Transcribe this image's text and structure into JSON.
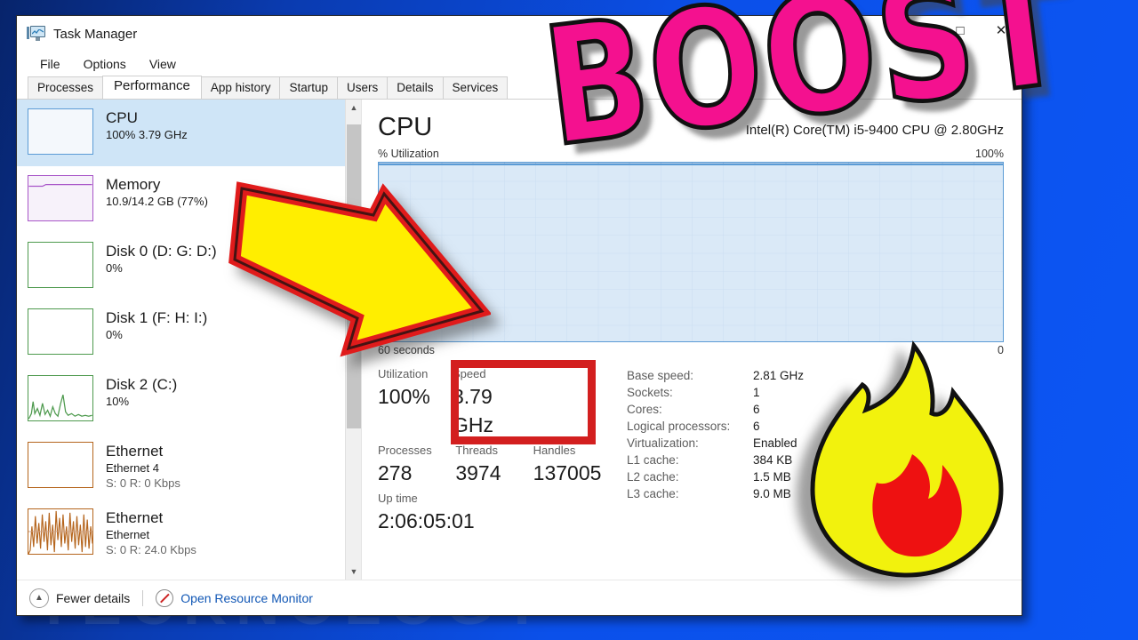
{
  "window": {
    "title": "Task Manager",
    "icon": "task-manager-icon",
    "controls": {
      "minimize": "–",
      "maximize": "□",
      "close": "✕"
    }
  },
  "menu": [
    "File",
    "Options",
    "View"
  ],
  "tabs": [
    {
      "label": "Processes",
      "active": false
    },
    {
      "label": "Performance",
      "active": true
    },
    {
      "label": "App history",
      "active": false
    },
    {
      "label": "Startup",
      "active": false
    },
    {
      "label": "Users",
      "active": false
    },
    {
      "label": "Details",
      "active": false
    },
    {
      "label": "Services",
      "active": false
    }
  ],
  "devices": [
    {
      "name": "CPU",
      "sub1": "100%  3.79 GHz",
      "sub2": "",
      "selected": true,
      "color": "#5b9bd5"
    },
    {
      "name": "Memory",
      "sub1": "10.9/14.2 GB (77%)",
      "sub2": "",
      "selected": false,
      "color": "#a855c8"
    },
    {
      "name": "Disk 0 (D: G: D:)",
      "sub1": "0%",
      "sub2": "",
      "selected": false,
      "color": "#4e9a4e"
    },
    {
      "name": "Disk 1 (F: H: I:)",
      "sub1": "0%",
      "sub2": "",
      "selected": false,
      "color": "#4e9a4e"
    },
    {
      "name": "Disk 2 (C:)",
      "sub1": "10%",
      "sub2": "",
      "selected": false,
      "color": "#4e9a4e"
    },
    {
      "name": "Ethernet",
      "sub1": "Ethernet 4",
      "sub2": "S: 0 R: 0 Kbps",
      "selected": false,
      "color": "#b5651d"
    },
    {
      "name": "Ethernet",
      "sub1": "Ethernet",
      "sub2": "S: 0 R: 24.0 Kbps",
      "selected": false,
      "color": "#b5651d"
    }
  ],
  "cpu": {
    "title": "CPU",
    "model": "Intel(R) Core(TM) i5-9400 CPU @ 2.80GHz",
    "graph_label": "% Utilization",
    "graph_max": "100%",
    "axis_left": "60 seconds",
    "axis_right": "0",
    "stats": [
      {
        "label": "Utilization",
        "value": "100%"
      },
      {
        "label": "Speed",
        "value": "3.79 GHz"
      },
      {
        "label": "Processes",
        "value": "278"
      },
      {
        "label": "Threads",
        "value": "3974"
      },
      {
        "label": "Handles",
        "value": "137005"
      },
      {
        "label": "Up time",
        "value": "2:06:05:01"
      }
    ],
    "specs": [
      {
        "key": "Base speed:",
        "value": "2.81 GHz"
      },
      {
        "key": "Sockets:",
        "value": "1"
      },
      {
        "key": "Cores:",
        "value": "6"
      },
      {
        "key": "Logical processors:",
        "value": "6"
      },
      {
        "key": "Virtualization:",
        "value": "Enabled"
      },
      {
        "key": "L1 cache:",
        "value": "384 KB"
      },
      {
        "key": "L2 cache:",
        "value": "1.5 MB"
      },
      {
        "key": "L3 cache:",
        "value": "9.0 MB"
      }
    ]
  },
  "footer": {
    "fewer_details": "Fewer details",
    "resource_monitor": "Open Resource Monitor"
  },
  "overlays": {
    "boost_text": "BOOST",
    "boost_color": "#f4118f",
    "arrow_fill": "#ffee00",
    "arrow_stroke": "#e01b1b",
    "flame_outer": "#f2f20d",
    "flame_inner": "#ee1111",
    "highlight_box_color": "#d31f1f",
    "watermark_text": "TECKNOLOGY"
  },
  "chart_data": {
    "type": "area",
    "title": "CPU % Utilization",
    "xlabel": "60 seconds",
    "ylabel": "% Utilization",
    "ylim": [
      0,
      100
    ],
    "x": [
      0,
      10,
      20,
      30,
      40,
      50,
      60
    ],
    "values": [
      100,
      100,
      100,
      100,
      100,
      100,
      100
    ],
    "grid": true,
    "legend": "none",
    "fill_color": "#d9e7f5",
    "line_color": "#5b9bd5"
  }
}
